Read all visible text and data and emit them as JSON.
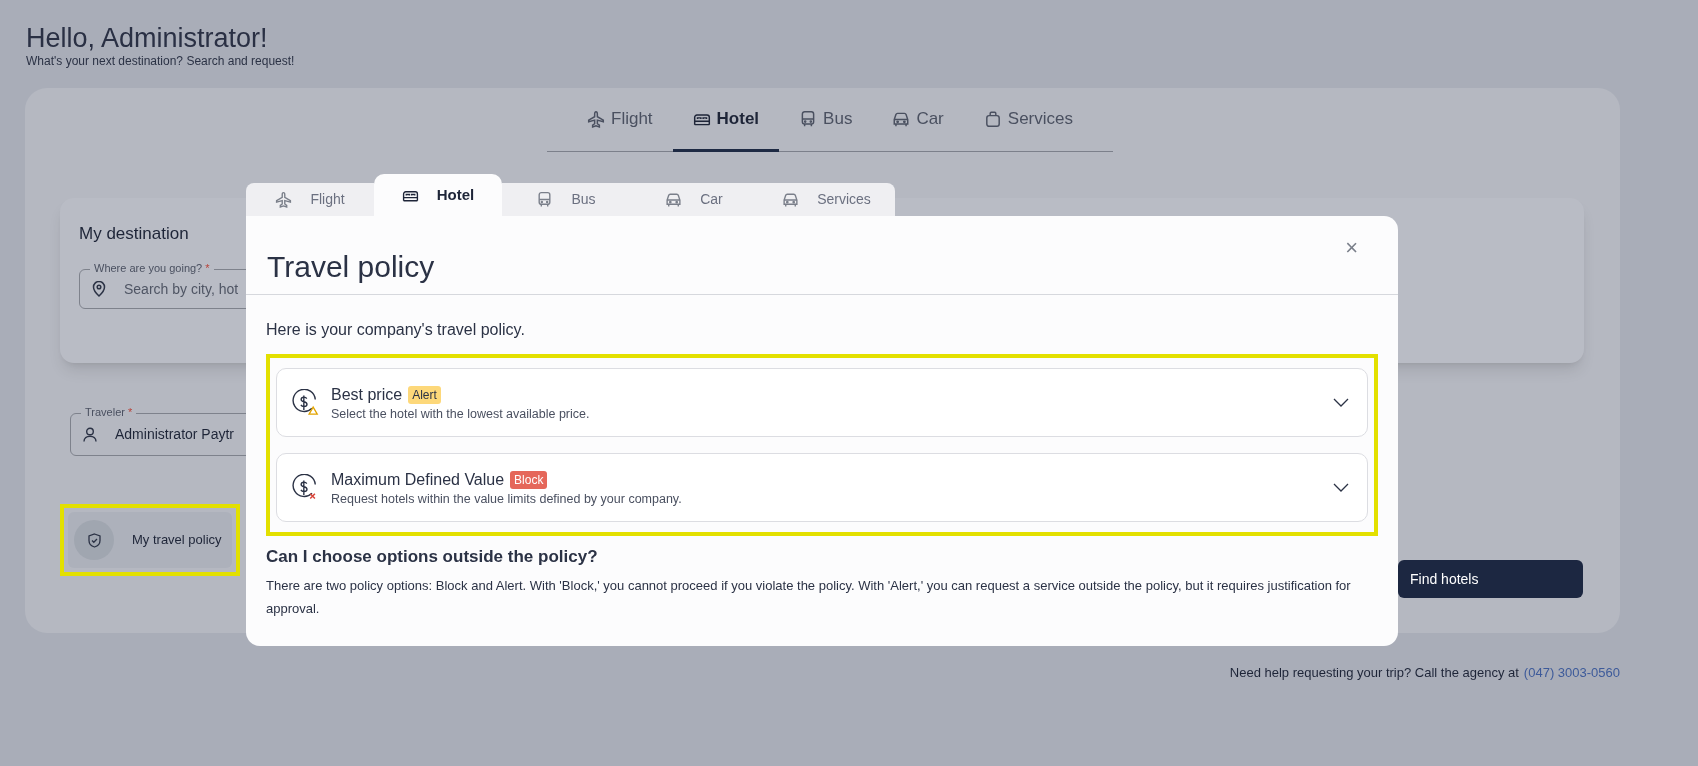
{
  "greeting": {
    "title": "Hello, Administrator!",
    "subtitle": "What's your next destination? Search and request!"
  },
  "search_tabs": [
    {
      "label": "Flight",
      "kind": "plane",
      "selected": false
    },
    {
      "label": "Hotel",
      "kind": "bed",
      "selected": true
    },
    {
      "label": "Bus",
      "kind": "bus",
      "selected": false
    },
    {
      "label": "Car",
      "kind": "car",
      "selected": false
    },
    {
      "label": "Services",
      "kind": "bag",
      "selected": false
    }
  ],
  "destination": {
    "title": "My destination",
    "field_label": "Where are you going?",
    "required_mark": "*",
    "placeholder": "Search by city, hot"
  },
  "traveler": {
    "label": "Traveler",
    "required_mark": "*",
    "value": "Administrator Paytr"
  },
  "policy_button": "My travel policy",
  "find_button": "Find hotels",
  "help": {
    "text": "Need help requesting your trip? Call the agency at",
    "phone": "(047) 3003-0560"
  },
  "modal": {
    "tabs": [
      {
        "label": "Flight",
        "kind": "plane",
        "selected": false
      },
      {
        "label": "Hotel",
        "kind": "bed",
        "selected": true
      },
      {
        "label": "Bus",
        "kind": "bus",
        "selected": false
      },
      {
        "label": "Car",
        "kind": "car",
        "selected": false
      },
      {
        "label": "Services",
        "kind": "car",
        "selected": false
      }
    ],
    "title": "Travel policy",
    "close": "×",
    "intro": "Here is your company's travel policy.",
    "policies": [
      {
        "title": "Best price",
        "badge": "Alert",
        "kind": "alert",
        "description": "Select the hotel with the lowest available price.",
        "expanded": false
      },
      {
        "title": "Maximum Defined Value",
        "badge": "Block",
        "kind": "block",
        "description": "Request hotels within the value limits defined by your company.",
        "expanded": false
      }
    ],
    "question": "Can I choose options outside the policy?",
    "answer": "There are two policy options: Block and Alert. With 'Block,' you cannot proceed if you violate the policy. With 'Alert,' you can request a service outside the policy, but it requires justification for approval."
  }
}
